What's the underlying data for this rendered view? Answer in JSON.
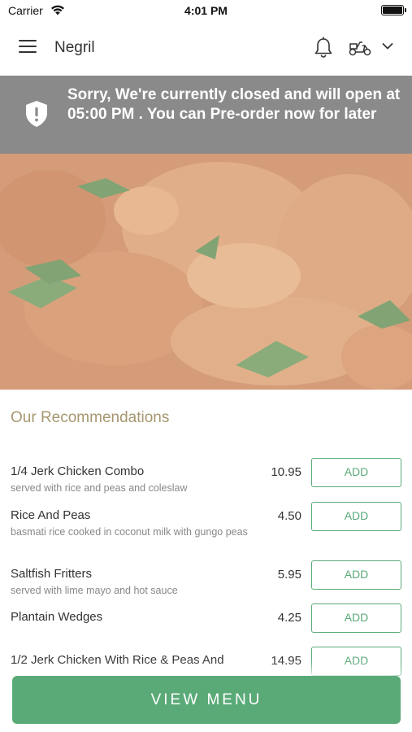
{
  "status_bar": {
    "carrier": "Carrier",
    "time": "4:01 PM"
  },
  "header": {
    "title": "Negril"
  },
  "banner": {
    "message": "Sorry, We're currently closed and will open at 05:00 PM . You can Pre-order now for later"
  },
  "section": {
    "title": "Our Recommendations"
  },
  "items": [
    {
      "name": "1/4 Jerk Chicken Combo",
      "description": "served with rice and peas and coleslaw",
      "price": "10.95",
      "button": "ADD"
    },
    {
      "name": "Rice And Peas",
      "description": "basmati rice cooked in coconut milk with gungo peas",
      "price": "4.50",
      "button": "ADD"
    },
    {
      "name": "Saltfish Fritters",
      "description": "served with lime mayo and hot sauce",
      "price": "5.95",
      "button": "ADD"
    },
    {
      "name": "Plantain Wedges",
      "description": "",
      "price": "4.25",
      "button": "ADD"
    },
    {
      "name": "1/2 Jerk Chicken With Rice & Peas And",
      "description": "",
      "price": "14.95",
      "button": "ADD"
    }
  ],
  "footer": {
    "view_menu": "VIEW MENU"
  },
  "colors": {
    "accent": "#5aaa78",
    "banner": "#8a8a8a",
    "section_title": "#a69770"
  }
}
